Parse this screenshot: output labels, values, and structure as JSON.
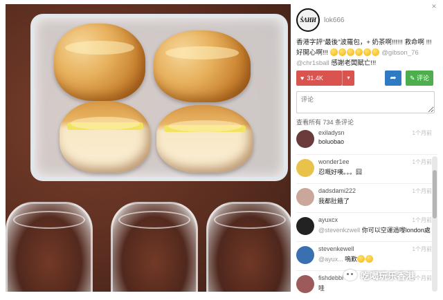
{
  "post": {
    "owner_avatar_text": "ṠΛИИ",
    "owner_name": "lok666",
    "caption_text": "香港字評“最後”波羅包，+ 奶茶啊!!!!!! 救命啊 !!! 好開心啊!!!",
    "caption_mention": "@gibson_76",
    "caption_mention_2": "@chr1sball",
    "caption_tail": "感謝老闆賦亡!!!",
    "like_count": "31.4K",
    "comment_label": "评论",
    "input_placeholder": "评论",
    "view_all": "查看所有 734 条评论"
  },
  "comments": [
    {
      "user": "exiladysn",
      "text": "boluobao",
      "mention": "",
      "time": "1个月前",
      "avatar_color": "#6b3a3a"
    },
    {
      "user": "wonder1ee",
      "text": "忍嘅好嘆。。。囧",
      "mention": "",
      "time": "1个月前",
      "avatar_color": "#e8c24a"
    },
    {
      "user": "dadsdami222",
      "text": "我都肚餓了",
      "mention": "",
      "time": "1个月前",
      "avatar_color": "#caa79a"
    },
    {
      "user": "ayuxcx",
      "text": "你可以空運過嚟london處",
      "mention": "@stevenkzwell",
      "time": "1个月前",
      "avatar_color": "#222222"
    },
    {
      "user": "stevenkewell",
      "text": "嗚歎",
      "mention": "@ayux...",
      "time": "1个月前",
      "avatar_color": "#3a6fb0"
    },
    {
      "user": "fishdebbi",
      "text": "哇",
      "mention": "",
      "time": "1个月前",
      "avatar_color": "#9c5a5a"
    }
  ],
  "watermark": "吃喝玩乐香港",
  "icons": {
    "close": "close-icon",
    "heart": "heart-icon",
    "share": "share-icon",
    "comment": "comment-icon",
    "caret": "chevron-down-icon",
    "wechat": "wechat-icon"
  },
  "colors": {
    "like": "#d9534f",
    "share": "#2e7bc4",
    "comment": "#4cae4c"
  }
}
